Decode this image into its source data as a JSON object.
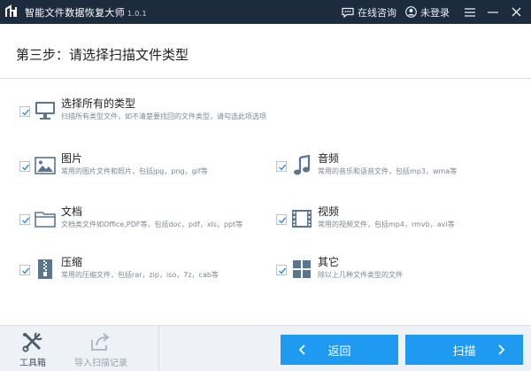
{
  "app": {
    "title": "智能文件数据恢复大师",
    "version": "1.0.1",
    "online_consult": "在线咨询",
    "login_status": "未登录"
  },
  "step": {
    "title": "第三步：请选择扫描文件类型"
  },
  "options": {
    "all": {
      "title": "选择所有的类型",
      "desc": "扫描所有类型文件，如不清楚要找回的文件类型，请勾选此项选项",
      "checked": true,
      "icon": "monitor-icon"
    },
    "image": {
      "title": "图片",
      "desc": "常用的图片文件和照片，包括jpg，png，gif等",
      "checked": true,
      "icon": "image-icon"
    },
    "audio": {
      "title": "音频",
      "desc": "常用的音乐和语音文件，包括mp3，wma等",
      "checked": true,
      "icon": "music-note-icon"
    },
    "document": {
      "title": "文档",
      "desc": "文档类文件如Office,PDF等，包括doc，pdf，xls，ppt等",
      "checked": true,
      "icon": "folder-icon"
    },
    "video": {
      "title": "视频",
      "desc": "常用的视频文件，包括mp4，rmvb，avi等",
      "checked": true,
      "icon": "film-icon"
    },
    "archive": {
      "title": "压缩",
      "desc": "常用的压缩文件，包括rar，zip，iso，7z，cab等",
      "checked": true,
      "icon": "zip-icon"
    },
    "other": {
      "title": "其它",
      "desc": "除以上几种文件类型的文件",
      "checked": true,
      "icon": "grid-icon"
    }
  },
  "footer": {
    "toolbox": "工具箱",
    "import_record": "导入扫描记录",
    "back": "返回",
    "scan": "扫描"
  },
  "colors": {
    "titlebar": "#1d2b3f",
    "accent": "#1e9bf0",
    "icon": "#5a7590",
    "check": "#2e8fd8"
  }
}
